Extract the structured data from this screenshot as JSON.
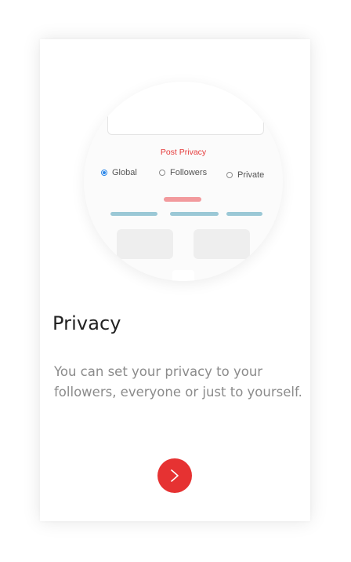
{
  "illustration": {
    "post_privacy_label": "Post Privacy",
    "options": [
      {
        "label": "Global",
        "selected": true
      },
      {
        "label": "Followers",
        "selected": false
      },
      {
        "label": "Private",
        "selected": false
      }
    ]
  },
  "onboarding": {
    "title": "Privacy",
    "description": "You can set your privacy to your followers, everyone or just to yourself."
  },
  "colors": {
    "accent": "#e63232",
    "radio_selected": "#2a86e8",
    "bar_pink": "#f29a9d",
    "bar_blue": "#9bc8d6"
  },
  "next_button": {
    "icon": "chevron-right-icon"
  }
}
